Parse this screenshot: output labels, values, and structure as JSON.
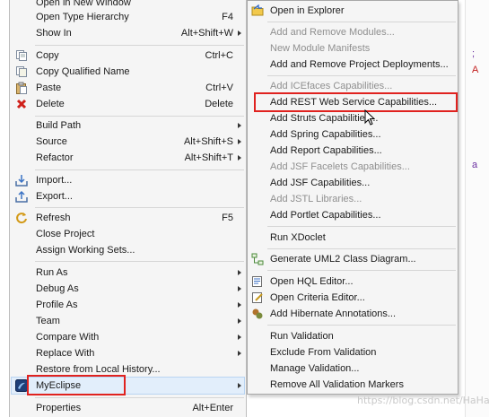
{
  "left_menu": {
    "items": [
      {
        "label": "Open in New Window",
        "shortcut": "",
        "submenu": false
      },
      {
        "label": "Open Type Hierarchy",
        "shortcut": "F4",
        "submenu": false
      },
      {
        "label": "Show In",
        "shortcut": "Alt+Shift+W",
        "submenu": true
      },
      {
        "label": "Copy",
        "shortcut": "Ctrl+C",
        "submenu": false,
        "icon": "copy-icon"
      },
      {
        "label": "Copy Qualified Name",
        "shortcut": "",
        "submenu": false,
        "icon": "copy-qualified-icon"
      },
      {
        "label": "Paste",
        "shortcut": "Ctrl+V",
        "submenu": false,
        "icon": "paste-icon"
      },
      {
        "label": "Delete",
        "shortcut": "Delete",
        "submenu": false,
        "icon": "delete-icon"
      },
      {
        "label": "Build Path",
        "shortcut": "",
        "submenu": true
      },
      {
        "label": "Source",
        "shortcut": "Alt+Shift+S",
        "submenu": true
      },
      {
        "label": "Refactor",
        "shortcut": "Alt+Shift+T",
        "submenu": true
      },
      {
        "label": "Import...",
        "shortcut": "",
        "submenu": false,
        "icon": "import-icon"
      },
      {
        "label": "Export...",
        "shortcut": "",
        "submenu": false,
        "icon": "export-icon"
      },
      {
        "label": "Refresh",
        "shortcut": "F5",
        "submenu": false,
        "icon": "refresh-icon"
      },
      {
        "label": "Close Project",
        "shortcut": "",
        "submenu": false
      },
      {
        "label": "Assign Working Sets...",
        "shortcut": "",
        "submenu": false
      },
      {
        "label": "Run As",
        "shortcut": "",
        "submenu": true
      },
      {
        "label": "Debug As",
        "shortcut": "",
        "submenu": true
      },
      {
        "label": "Profile As",
        "shortcut": "",
        "submenu": true
      },
      {
        "label": "Team",
        "shortcut": "",
        "submenu": true
      },
      {
        "label": "Compare With",
        "shortcut": "",
        "submenu": true
      },
      {
        "label": "Replace With",
        "shortcut": "",
        "submenu": true
      },
      {
        "label": "Restore from Local History...",
        "shortcut": "",
        "submenu": false
      },
      {
        "label": "MyEclipse",
        "shortcut": "",
        "submenu": true,
        "icon": "myeclipse-icon",
        "selected": true
      },
      {
        "label": "Properties",
        "shortcut": "Alt+Enter",
        "submenu": false
      }
    ]
  },
  "right_menu": {
    "items": [
      {
        "label": "Open in Explorer",
        "disabled": false,
        "icon": "folder-icon"
      },
      {
        "label": "Add and Remove Modules...",
        "disabled": true
      },
      {
        "label": "New Module Manifests",
        "disabled": true
      },
      {
        "label": "Add and Remove Project Deployments...",
        "disabled": false
      },
      {
        "label": "Add ICEfaces Capabilities...",
        "disabled": true
      },
      {
        "label": "Add REST Web Service Capabilities...",
        "disabled": false,
        "selected": true
      },
      {
        "label": "Add Struts Capabilities...",
        "disabled": false
      },
      {
        "label": "Add Spring Capabilities...",
        "disabled": false
      },
      {
        "label": "Add Report Capabilities...",
        "disabled": false
      },
      {
        "label": "Add JSF Facelets Capabilities...",
        "disabled": true
      },
      {
        "label": "Add JSF Capabilities...",
        "disabled": false
      },
      {
        "label": "Add JSTL Libraries...",
        "disabled": true
      },
      {
        "label": "Add Portlet Capabilities...",
        "disabled": false
      },
      {
        "label": "Run XDoclet",
        "disabled": false
      },
      {
        "label": "Generate UML2 Class Diagram...",
        "disabled": false,
        "icon": "uml-icon"
      },
      {
        "label": "Open HQL Editor...",
        "disabled": false,
        "icon": "hql-icon"
      },
      {
        "label": "Open Criteria Editor...",
        "disabled": false,
        "icon": "criteria-icon"
      },
      {
        "label": "Add Hibernate Annotations...",
        "disabled": false,
        "icon": "hibernate-icon"
      },
      {
        "label": "Run Validation",
        "disabled": false
      },
      {
        "label": "Exclude From Validation",
        "disabled": false
      },
      {
        "label": "Manage Validation...",
        "disabled": false
      },
      {
        "label": "Remove All Validation Markers",
        "disabled": false
      }
    ]
  },
  "watermark": "https://blog.csdn.net/HaHa_Sir",
  "colors": {
    "menu_bg": "#f5f5f5",
    "highlight_box": "#e0221f",
    "disabled_text": "#8f8f8f",
    "selection_bg": "#e2eefb"
  }
}
